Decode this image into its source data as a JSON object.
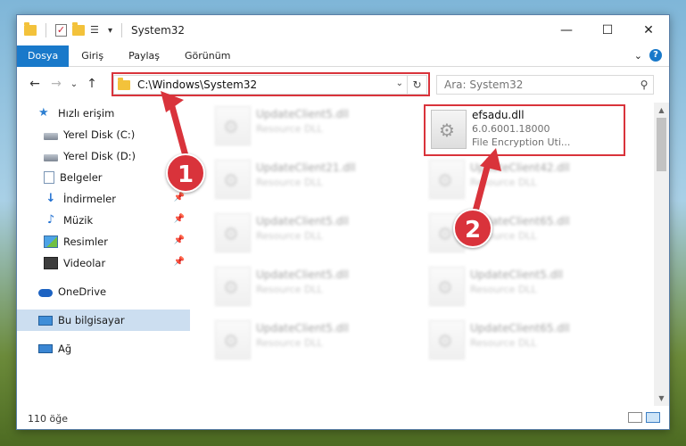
{
  "window": {
    "title": "System32",
    "controls": {
      "minimize": "—",
      "maximize": "☐",
      "close": "✕"
    }
  },
  "ribbon": {
    "tabs": [
      "Dosya",
      "Giriş",
      "Paylaş",
      "Görünüm"
    ],
    "expand": "⌄",
    "help": "?"
  },
  "nav": {
    "back": "←",
    "forward": "→",
    "recent": "⌄",
    "up": "↑",
    "address": "C:\\Windows\\System32",
    "dropdown": "⌄",
    "refresh": "↻",
    "search_placeholder": "Ara: System32",
    "search_icon": "⚲"
  },
  "sidebar": {
    "items": [
      {
        "label": "Hızlı erişim",
        "icon": "star-icon"
      },
      {
        "label": "Yerel Disk (C:)",
        "icon": "disk-icon"
      },
      {
        "label": "Yerel Disk (D:)",
        "icon": "disk-icon"
      },
      {
        "label": "Belgeler",
        "icon": "document-icon"
      },
      {
        "label": "İndirmeler",
        "icon": "download-icon",
        "pinned": true
      },
      {
        "label": "Müzik",
        "icon": "music-icon",
        "pinned": true
      },
      {
        "label": "Resimler",
        "icon": "pictures-icon",
        "pinned": true
      },
      {
        "label": "Videolar",
        "icon": "video-icon",
        "pinned": true
      },
      {
        "label": "OneDrive",
        "icon": "cloud-icon"
      },
      {
        "label": "Bu bilgisayar",
        "icon": "computer-icon",
        "selected": true
      },
      {
        "label": "Ağ",
        "icon": "network-icon"
      }
    ],
    "pin_glyph": "📌"
  },
  "files": {
    "left": [
      {
        "name": "UpdateClient5.dll",
        "desc": "Resource DLL"
      },
      {
        "name": "UpdateClient21.dll",
        "desc": "Resource DLL"
      },
      {
        "name": "UpdateClient5.dll",
        "desc": "Resource DLL"
      },
      {
        "name": "UpdateClient5.dll",
        "desc": "Resource DLL"
      },
      {
        "name": "UpdateClient5.dll",
        "desc": "Resource DLL"
      }
    ],
    "right": [
      {
        "name": "efsadu.dll",
        "desc": "6.0.6001.18000",
        "desc2": "File Encryption Uti..."
      },
      {
        "name": "UpdateClient42.dll",
        "desc": "Resource DLL"
      },
      {
        "name": "UpdateClient65.dll",
        "desc": "Resource DLL"
      },
      {
        "name": "UpdateClient5.dll",
        "desc": "Resource DLL"
      },
      {
        "name": "UpdateClient65.dll",
        "desc": "Resource DLL"
      }
    ]
  },
  "status": {
    "count": "110 öğe"
  },
  "callouts": {
    "one": "1",
    "two": "2"
  },
  "colors": {
    "accent": "#1979ca",
    "highlight": "#d9333b",
    "selection": "#ccdef0"
  }
}
